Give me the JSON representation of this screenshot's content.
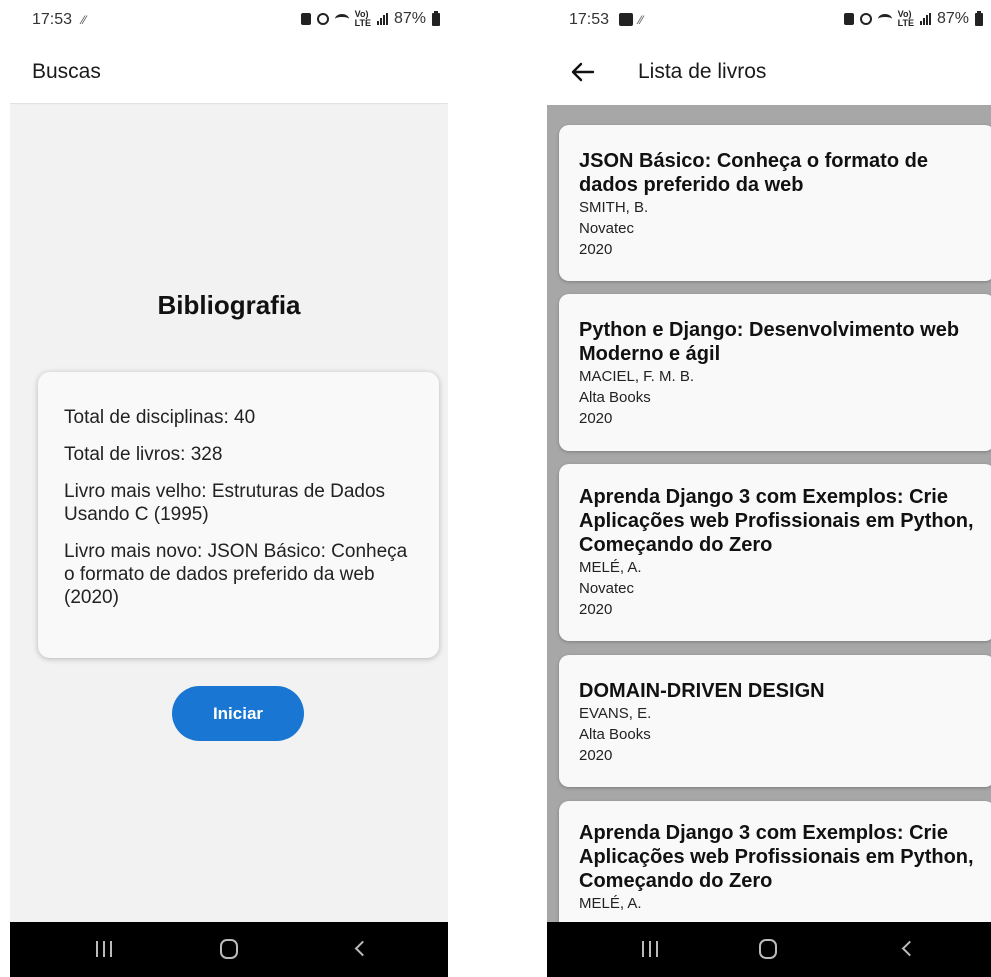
{
  "left": {
    "status": {
      "time": "17:53",
      "vib": "⁄⁄",
      "lte": "Vo)\nLTE",
      "battery": "87%"
    },
    "appbar": {
      "title": "Buscas"
    },
    "heading": "Bibliografia",
    "stats": [
      "Total de disciplinas: 40",
      "Total de livros: 328",
      "Livro mais velho: Estruturas de Dados Usando C (1995)",
      "Livro mais novo: JSON Básico: Conheça o formato de dados preferido da web (2020)"
    ],
    "start_button": "Iniciar"
  },
  "right": {
    "status": {
      "time": "17:53",
      "vib": "⁄⁄",
      "lte": "Vo)\nLTE",
      "battery": "87%"
    },
    "appbar": {
      "title": "Lista de livros"
    },
    "books": [
      {
        "title": "JSON Básico: Conheça o formato de dados preferido da web",
        "author": "SMITH, B.",
        "publisher": "Novatec",
        "year": "2020"
      },
      {
        "title": "Python e Django: Desenvolvimento web Moderno e ágil",
        "author": "MACIEL, F. M. B.",
        "publisher": "Alta Books",
        "year": "2020"
      },
      {
        "title": "Aprenda Django 3 com Exemplos: Crie Aplicações web Profissionais em Python, Começando do Zero",
        "author": "MELÉ, A.",
        "publisher": "Novatec",
        "year": "2020"
      },
      {
        "title": "DOMAIN-DRIVEN DESIGN",
        "author": "EVANS, E.",
        "publisher": "Alta Books",
        "year": "2020"
      },
      {
        "title": "Aprenda Django 3 com Exemplos: Crie Aplicações web Profissionais em Python, Começando do Zero",
        "author": "MELÉ, A.",
        "publisher": "",
        "year": ""
      }
    ]
  },
  "colors": {
    "accent": "#1976d2",
    "list_background": "#a7a7a7",
    "screen_background": "#f2f2f2",
    "navbar": "#000000"
  }
}
